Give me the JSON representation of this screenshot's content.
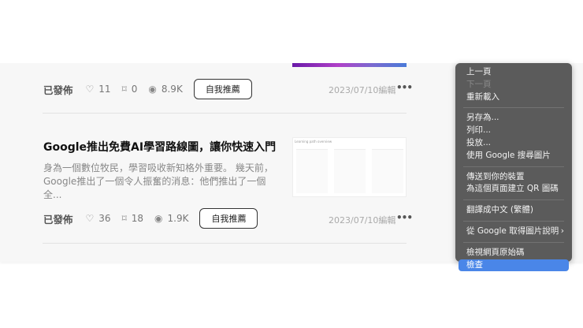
{
  "articles": [
    {
      "status": "已發佈",
      "likes": "11",
      "bookmarks": "0",
      "views": "8.9K",
      "promote_label": "自我推薦",
      "date": "2023/07/10編輯"
    },
    {
      "title": "Google推出免費AI學習路線圖，讓你快速入門",
      "excerpt": "身為一個數位牧民，學習吸收新知格外重要。 幾天前，Google推出了一個令人振奮的消息：他們推出了一個全...",
      "thumb_caption": "Learning path overview",
      "status": "已發佈",
      "likes": "36",
      "bookmarks": "18",
      "views": "1.9K",
      "promote_label": "自我推薦",
      "date": "2023/07/10編輯"
    }
  ],
  "context_menu": {
    "items": [
      {
        "label": "上一頁"
      },
      {
        "label": "下一頁",
        "disabled": true
      },
      {
        "label": "重新載入"
      },
      {
        "label": "另存為..."
      },
      {
        "label": "列印..."
      },
      {
        "label": "投放..."
      },
      {
        "label": "使用 Google 搜尋圖片"
      },
      {
        "label": "傳送到你的裝置"
      },
      {
        "label": "為這個頁面建立 QR 圖碼"
      },
      {
        "label": "翻譯成中文 (繁體)"
      },
      {
        "label": "從 Google 取得圖片說明"
      },
      {
        "label": "檢視網頁原始碼"
      },
      {
        "label": "檢查",
        "highlighted": true
      }
    ]
  }
}
